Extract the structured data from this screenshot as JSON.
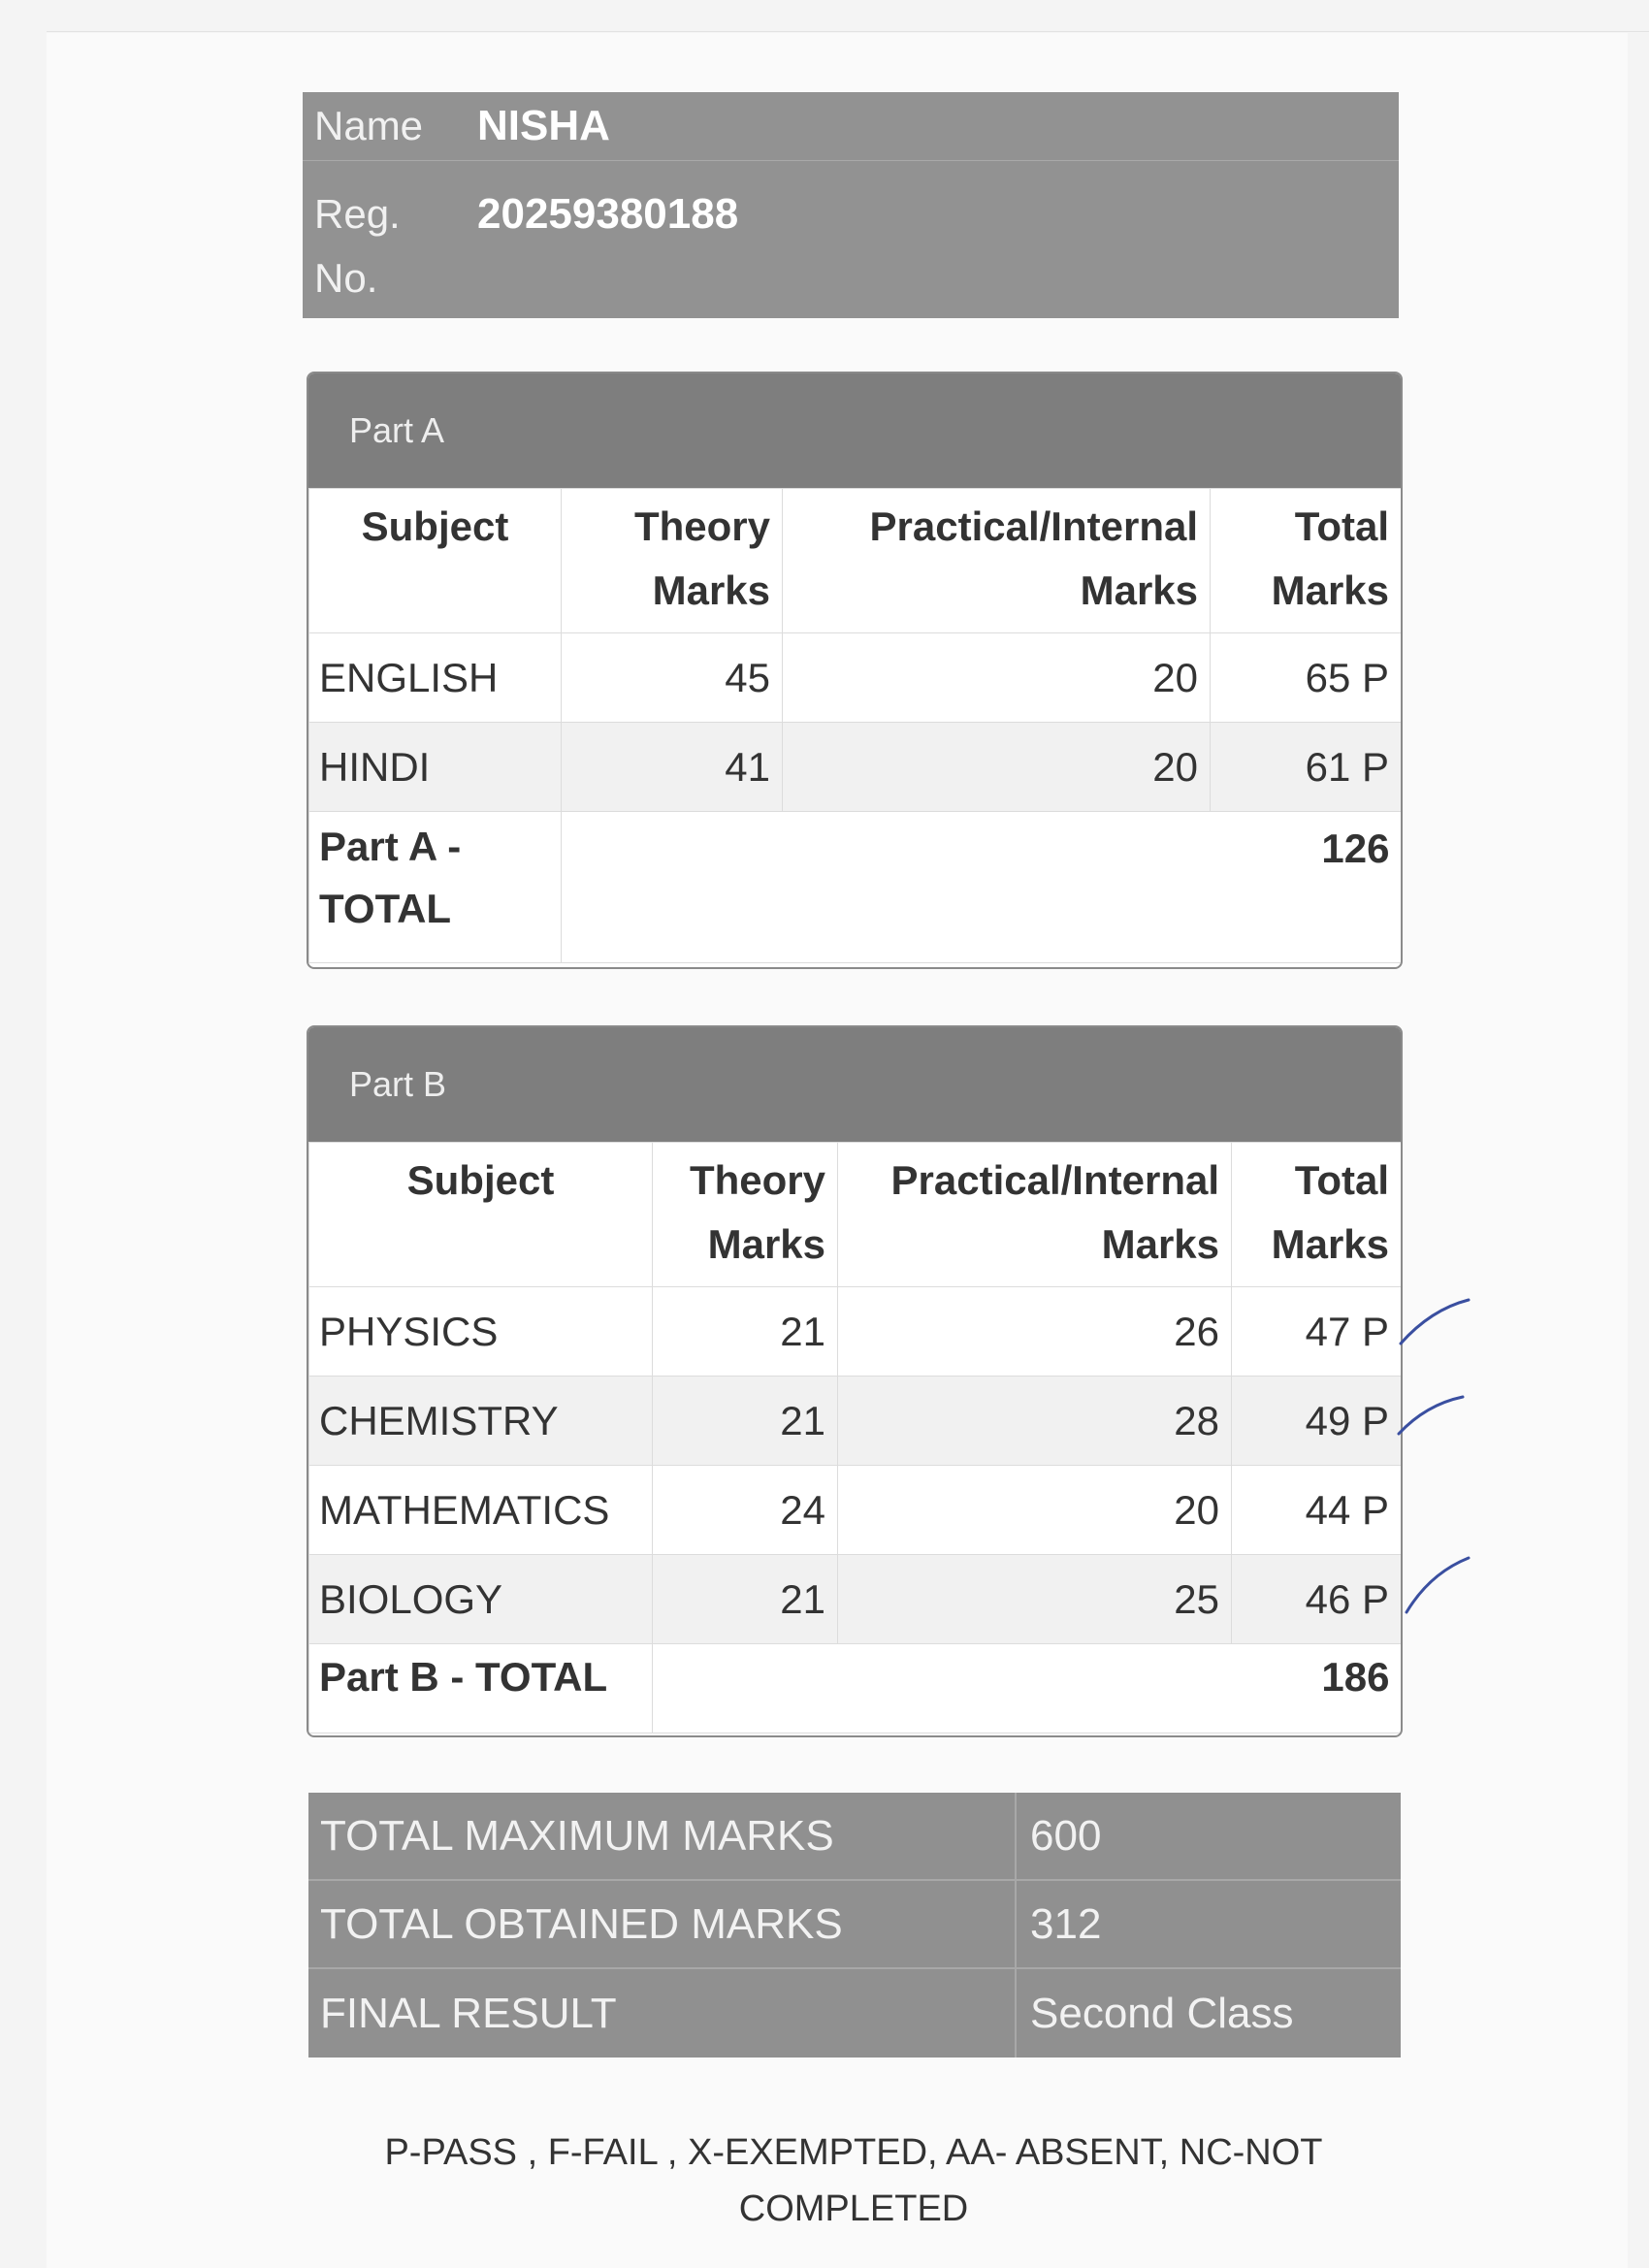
{
  "student": {
    "name_label": "Name",
    "name": "NISHA",
    "reg_label_line1": "Reg.",
    "reg_label_line2": "No.",
    "reg_no": "20259380188"
  },
  "columns": {
    "subject": "Subject",
    "theory_1": "Theory",
    "theory_2": "Marks",
    "practical_1": "Practical/Internal",
    "practical_2": "Marks",
    "total_1": "Total",
    "total_2": "Marks"
  },
  "part_a": {
    "title": "Part A",
    "rows": [
      {
        "subject": "ENGLISH",
        "theory": "45",
        "practical": "20",
        "total": "65 P"
      },
      {
        "subject": "HINDI",
        "theory": "41",
        "practical": "20",
        "total": "61 P"
      }
    ],
    "total_label_line1": "Part A -",
    "total_label_line2": "TOTAL",
    "total": "126"
  },
  "part_b": {
    "title": "Part B",
    "rows": [
      {
        "subject": "PHYSICS",
        "theory": "21",
        "practical": "26",
        "total": "47 P"
      },
      {
        "subject": "CHEMISTRY",
        "theory": "21",
        "practical": "28",
        "total": "49 P"
      },
      {
        "subject": "MATHEMATICS",
        "theory": "24",
        "practical": "20",
        "total": "44 P"
      },
      {
        "subject": "BIOLOGY",
        "theory": "21",
        "practical": "25",
        "total": "46 P"
      }
    ],
    "total_label": "Part B - TOTAL",
    "total": "186"
  },
  "summary": [
    {
      "label": "TOTAL MAXIMUM MARKS",
      "value": "600"
    },
    {
      "label": "TOTAL OBTAINED MARKS",
      "value": "312"
    },
    {
      "label": "FINAL RESULT",
      "value": "Second Class"
    }
  ],
  "legend": {
    "line1": "P-PASS , F-FAIL , X-EXEMPTED, AA- ABSENT, NC-NOT",
    "line2": "COMPLETED"
  },
  "colors": {
    "header_gray": "#7e7e7e",
    "card_gray": "#929292",
    "pen_ink": "#3a4fa0"
  }
}
